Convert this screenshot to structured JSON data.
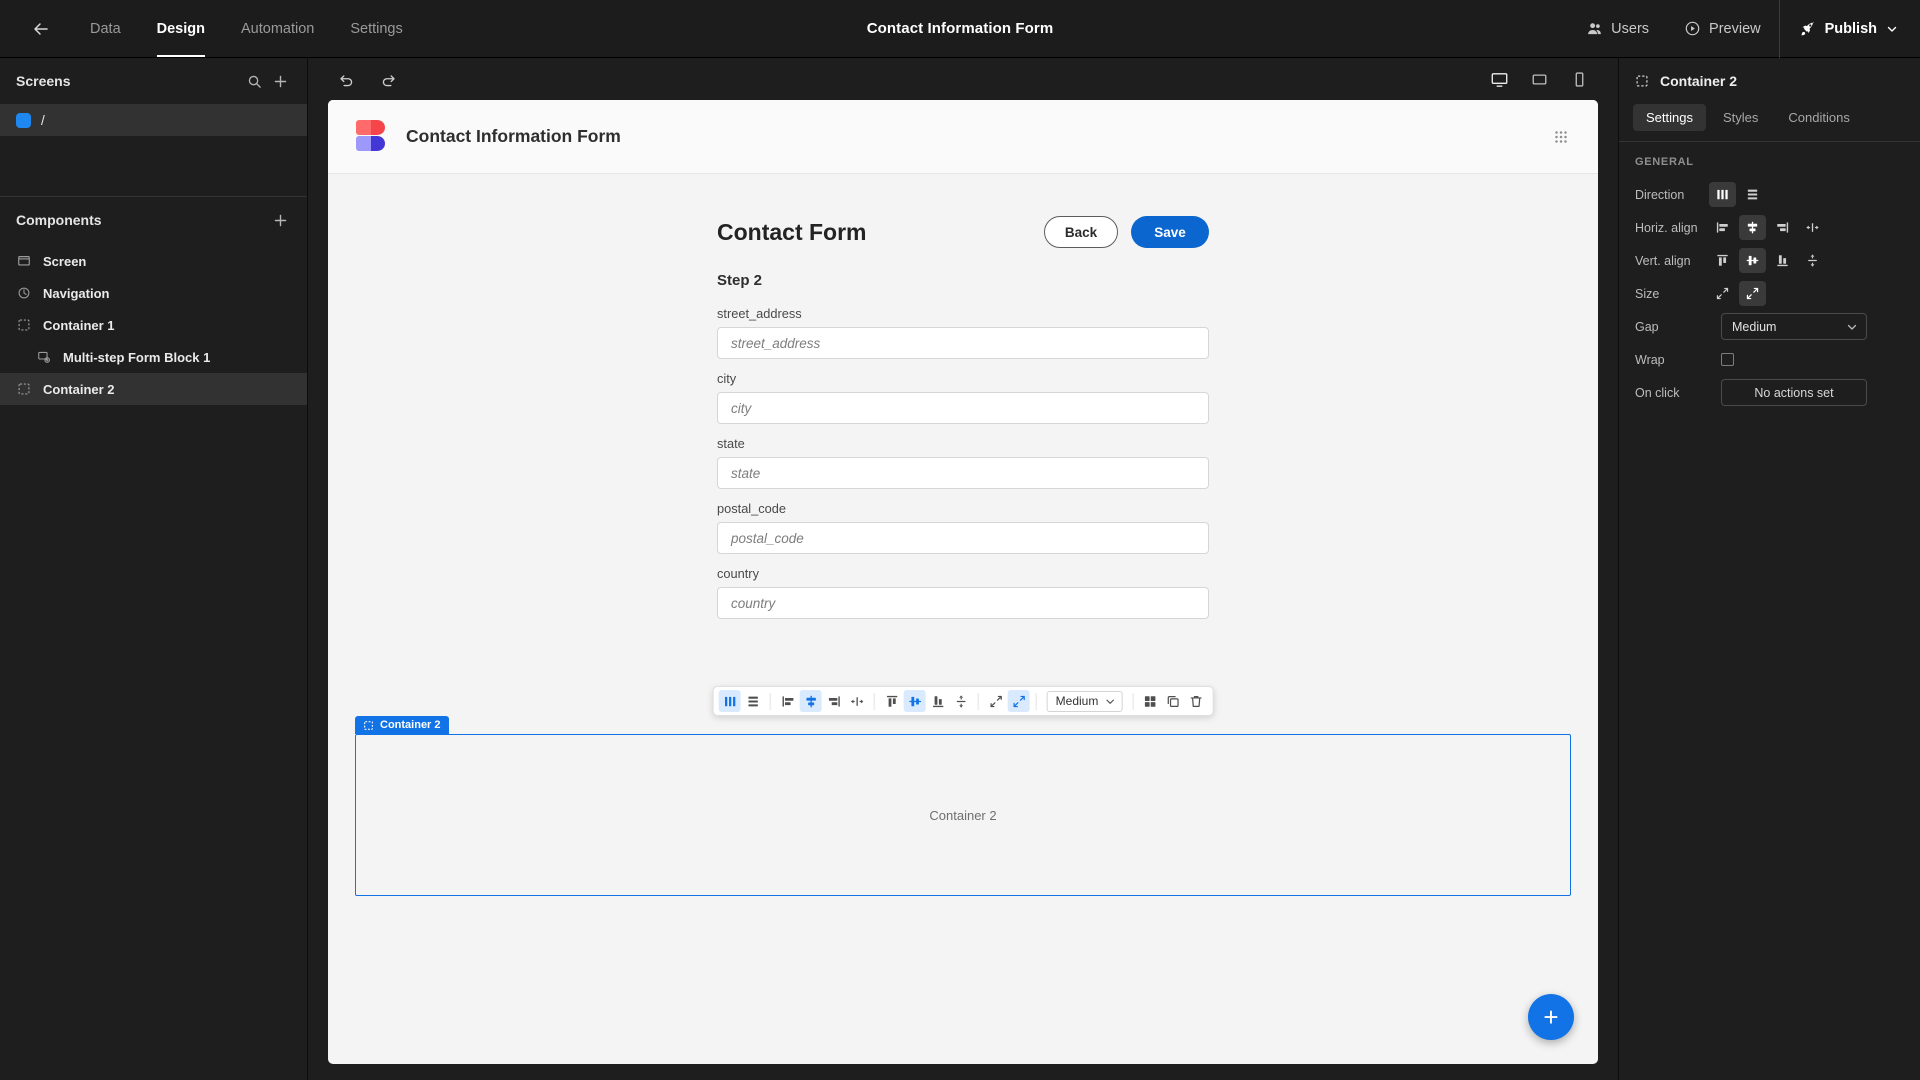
{
  "topbar": {
    "back_icon": "back-arrow-icon",
    "nav": [
      {
        "label": "Data",
        "active": false
      },
      {
        "label": "Design",
        "active": true
      },
      {
        "label": "Automation",
        "active": false
      },
      {
        "label": "Settings",
        "active": false
      }
    ],
    "app_title": "Contact Information Form",
    "users_label": "Users",
    "preview_label": "Preview",
    "publish_label": "Publish"
  },
  "left_panel": {
    "screens_title": "Screens",
    "screens": [
      {
        "label": "/"
      }
    ],
    "components_title": "Components",
    "components": [
      {
        "label": "Screen",
        "icon": "screen-icon",
        "indent": false,
        "selected": false
      },
      {
        "label": "Navigation",
        "icon": "navigation-icon",
        "indent": false,
        "selected": false
      },
      {
        "label": "Container 1",
        "icon": "container-icon",
        "indent": false,
        "selected": false
      },
      {
        "label": "Multi-step Form Block 1",
        "icon": "form-block-icon",
        "indent": true,
        "selected": false
      },
      {
        "label": "Container 2",
        "icon": "container-icon",
        "indent": false,
        "selected": true
      }
    ]
  },
  "canvas": {
    "page_title": "Contact Information Form",
    "form": {
      "heading": "Contact Form",
      "back_label": "Back",
      "save_label": "Save",
      "step_label": "Step 2",
      "fields": [
        {
          "label": "street_address",
          "value": "",
          "placeholder": "street_address"
        },
        {
          "label": "city",
          "value": "",
          "placeholder": "city"
        },
        {
          "label": "state",
          "value": "",
          "placeholder": "state"
        },
        {
          "label": "postal_code",
          "value": "",
          "placeholder": "postal_code"
        },
        {
          "label": "country",
          "value": "",
          "placeholder": "country"
        }
      ]
    },
    "float_toolbar": {
      "gap_value": "Medium",
      "items": [
        {
          "name": "direction-horizontal",
          "active": true
        },
        {
          "name": "direction-vertical",
          "active": false
        },
        {
          "name": "halign-left",
          "active": false
        },
        {
          "name": "halign-center",
          "active": true
        },
        {
          "name": "halign-right",
          "active": false
        },
        {
          "name": "halign-space-between",
          "active": false
        },
        {
          "name": "valign-top",
          "active": false
        },
        {
          "name": "valign-middle",
          "active": true
        },
        {
          "name": "valign-bottom",
          "active": false
        },
        {
          "name": "valign-stretch",
          "active": false
        },
        {
          "name": "size-shrink",
          "active": false
        },
        {
          "name": "size-grow",
          "active": true
        }
      ]
    },
    "dropzone": {
      "badge": "Container 2",
      "placeholder": "Container 2"
    },
    "fab_label": "+"
  },
  "right_panel": {
    "title": "Container 2",
    "tabs": [
      {
        "label": "Settings",
        "active": true
      },
      {
        "label": "Styles",
        "active": false
      },
      {
        "label": "Conditions",
        "active": false
      }
    ],
    "section_title": "GENERAL",
    "props": {
      "direction_label": "Direction",
      "halign_label": "Horiz. align",
      "valign_label": "Vert. align",
      "size_label": "Size",
      "gap_label": "Gap",
      "gap_value": "Medium",
      "wrap_label": "Wrap",
      "onclick_label": "On click",
      "onclick_value": "No actions set"
    }
  },
  "colors": {
    "accent_blue": "#1273e6",
    "save_blue": "#0b66d0",
    "panel_bg": "#1e1e1e",
    "canvas_bg": "#f4f4f4"
  }
}
